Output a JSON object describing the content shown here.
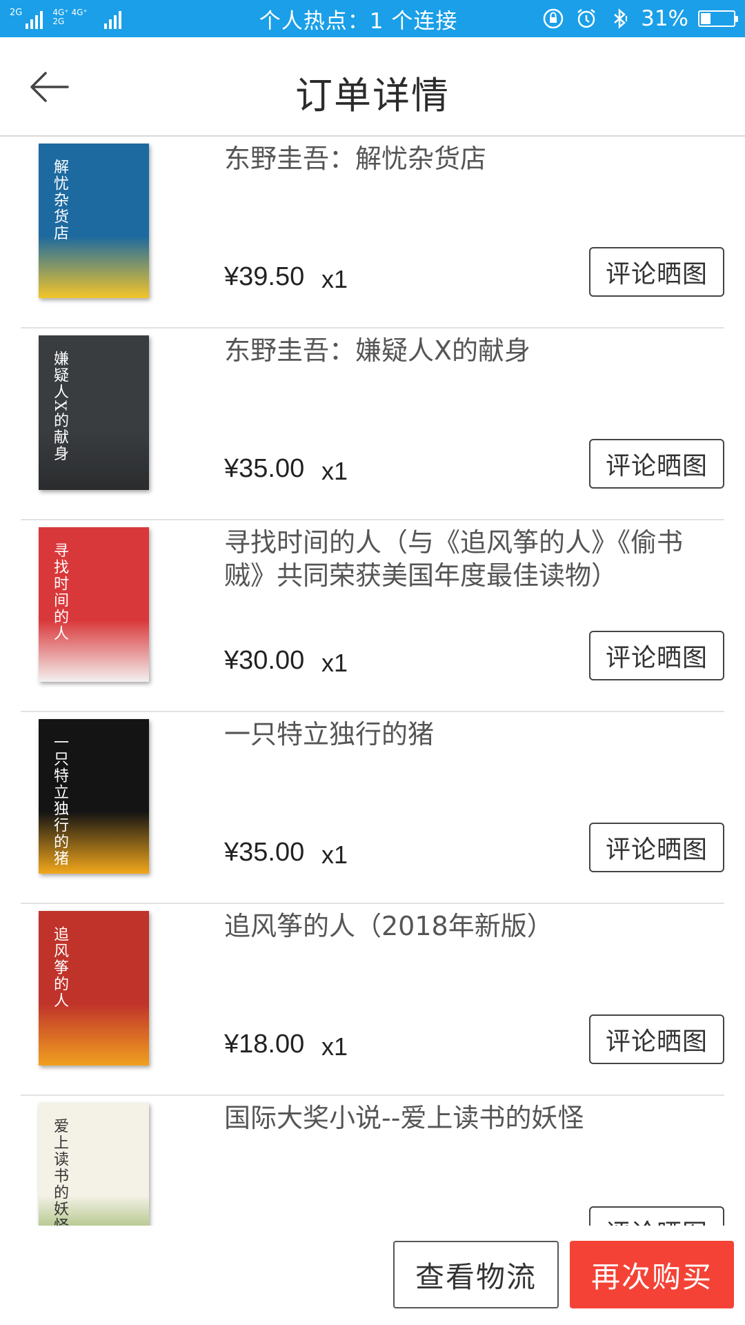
{
  "status_bar": {
    "sim1_label": "2G",
    "sim2_label": "4G⁺ 4G⁺ 2G",
    "center_text": "个人热点：1 个连接",
    "battery_text": "31%",
    "battery_level": 0.31,
    "icons": [
      "signal-icon",
      "lock-rotation-icon",
      "alarm-icon",
      "bluetooth-icon",
      "battery-icon"
    ]
  },
  "header": {
    "title": "订单详情",
    "back_icon": "back-arrow-icon"
  },
  "items": [
    {
      "name": "东野圭吾：解忧杂货店",
      "price": "¥39.50",
      "qty": "x1",
      "review_label": "评论晒图",
      "cover_title": "解忧杂货店",
      "cover_colors": [
        "#1d6aa0",
        "#f3c52a"
      ]
    },
    {
      "name": "东野圭吾：嫌疑人X的献身",
      "price": "¥35.00",
      "qty": "x1",
      "review_label": "评论晒图",
      "cover_title": "嫌疑人X的献身",
      "cover_colors": [
        "#3a3d40",
        "#2a2c2e"
      ]
    },
    {
      "name": "寻找时间的人（与《追风筝的人》《偷书贼》共同荣获美国年度最佳读物）",
      "price": "¥30.00",
      "qty": "x1",
      "review_label": "评论晒图",
      "cover_title": "寻找时间的人",
      "cover_colors": [
        "#d9383a",
        "#f4f0f0"
      ]
    },
    {
      "name": "一只特立独行的猪",
      "price": "¥35.00",
      "qty": "x1",
      "review_label": "评论晒图",
      "cover_title": "一只特立独行的猪",
      "cover_colors": [
        "#141414",
        "#f2a71b"
      ]
    },
    {
      "name": "追风筝的人（2018年新版）",
      "price": "¥18.00",
      "qty": "x1",
      "review_label": "评论晒图",
      "cover_title": "追风筝的人",
      "cover_colors": [
        "#c0332a",
        "#f0a020"
      ]
    },
    {
      "name": "国际大奖小说--爱上读书的妖怪",
      "price": "",
      "qty": "",
      "review_label": "评论晒图",
      "cover_title": "爱上读书的妖怪",
      "cover_colors": [
        "#f4f1e6",
        "#7aa23c"
      ]
    }
  ],
  "bottom_bar": {
    "logistics_label": "查看物流",
    "rebuy_label": "再次购买",
    "rebuy_color": "#f44336"
  }
}
